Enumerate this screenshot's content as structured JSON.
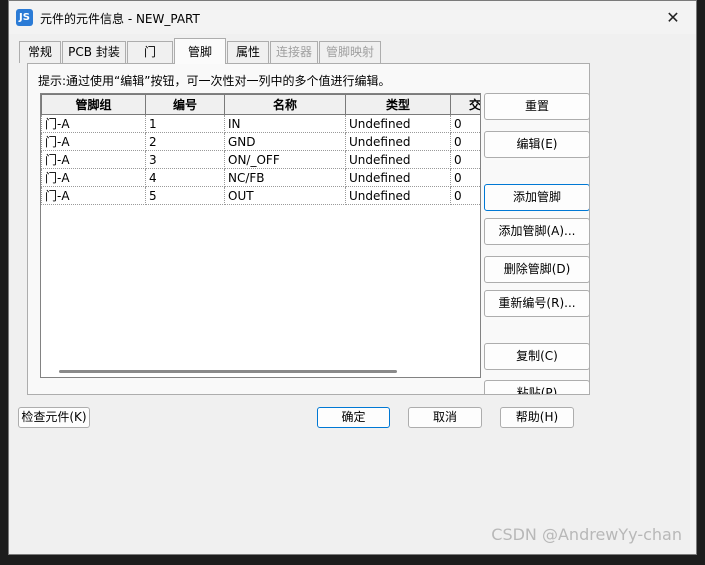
{
  "window": {
    "title": "元件的元件信息 - NEW_PART",
    "icon_text": "JS",
    "close": "✕"
  },
  "tabs": [
    {
      "label": "常规"
    },
    {
      "label": "PCB 封装"
    },
    {
      "label": "门"
    },
    {
      "label": "管脚"
    },
    {
      "label": "属性"
    },
    {
      "label": "连接器"
    },
    {
      "label": "管脚映射"
    }
  ],
  "hint": "提示:通过使用“编辑”按钮，可一次性对一列中的多个值进行编辑。",
  "table": {
    "headers": [
      "管脚组",
      "编号",
      "名称",
      "类型",
      "交换"
    ],
    "rows": [
      [
        "门-A",
        "1",
        "IN",
        "Undefined",
        "0"
      ],
      [
        "门-A",
        "2",
        "GND",
        "Undefined",
        "0"
      ],
      [
        "门-A",
        "3",
        "ON/_OFF",
        "Undefined",
        "0"
      ],
      [
        "门-A",
        "4",
        "NC/FB",
        "Undefined",
        "0"
      ],
      [
        "门-A",
        "5",
        "OUT",
        "Undefined",
        "0"
      ]
    ]
  },
  "side_buttons": {
    "reset": "重置",
    "edit": "编辑(E)",
    "add_pin": "添加管脚",
    "add_pins": "添加管脚(A)...",
    "delete_pin": "删除管脚(D)",
    "renumber": "重新编号(R)...",
    "copy": "复制(C)",
    "paste": "粘贴(P)"
  },
  "bottom_buttons": {
    "check": "检查元件(K)",
    "ok": "确定",
    "cancel": "取消",
    "help": "帮助(H)"
  },
  "watermark": "CSDN @AndrewYy-chan"
}
